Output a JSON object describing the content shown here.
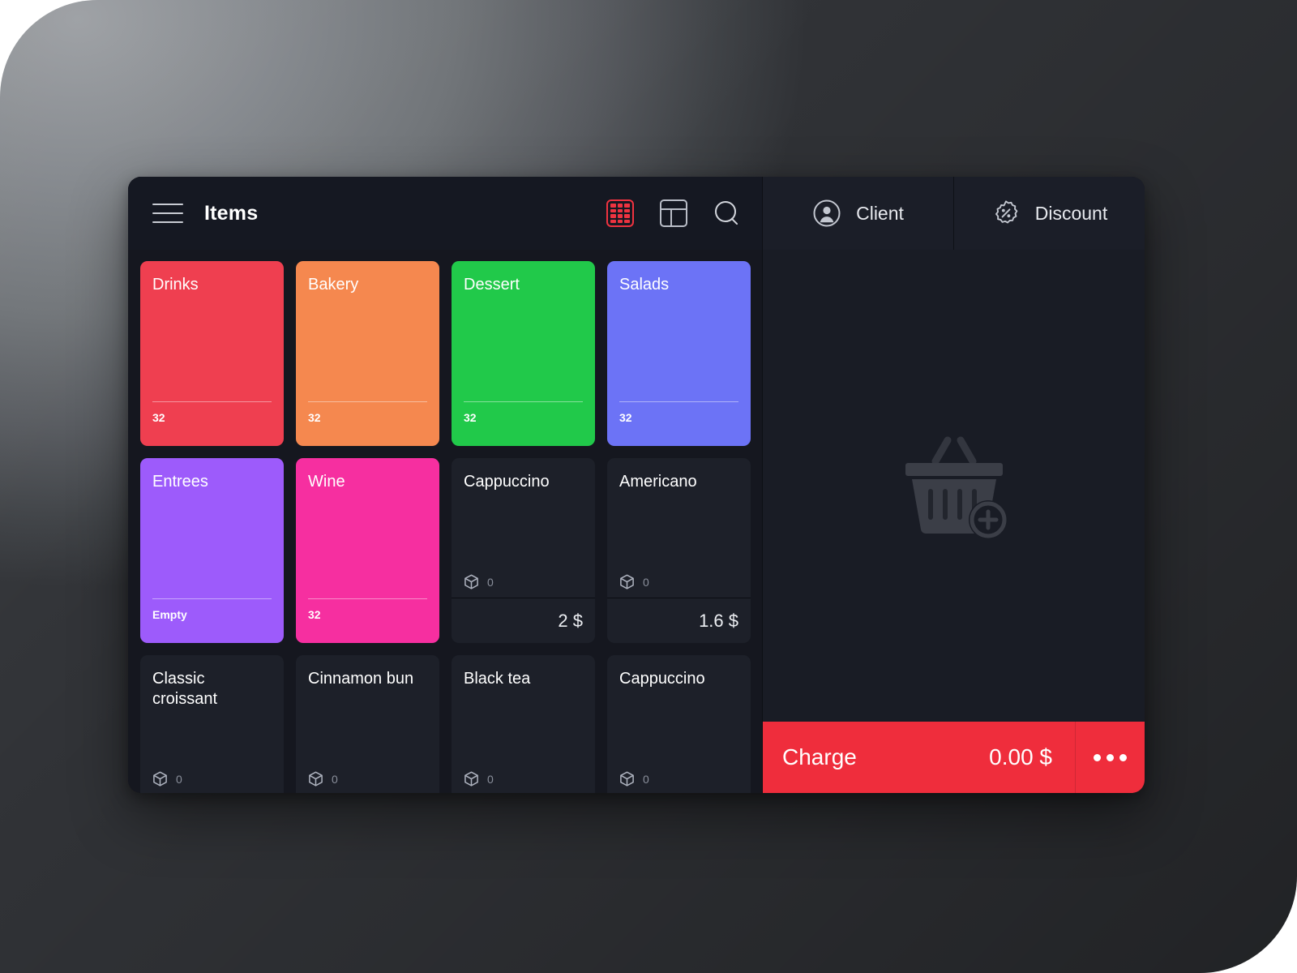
{
  "app": {
    "theme": {
      "panel_bg": "#15171f",
      "tile_bg": "#1d2029",
      "cart_bg": "#191c25",
      "accent_red": "#ef2d3c"
    }
  },
  "items_header": {
    "menu_icon": "hamburger-icon",
    "title": "Items",
    "tools": [
      {
        "name": "grid-view-icon",
        "active": true
      },
      {
        "name": "table-view-icon",
        "active": false
      },
      {
        "name": "search-icon",
        "active": false
      }
    ]
  },
  "tiles": [
    {
      "kind": "category",
      "name": "Drinks",
      "count": "32",
      "color": "#ef3f50"
    },
    {
      "kind": "category",
      "name": "Bakery",
      "count": "32",
      "color": "#f5884f"
    },
    {
      "kind": "category",
      "name": "Dessert",
      "count": "32",
      "color": "#21c94a"
    },
    {
      "kind": "category",
      "name": "Salads",
      "count": "32",
      "color": "#6c73f6"
    },
    {
      "kind": "category",
      "name": "Entrees",
      "count": "Empty",
      "color": "#9d5bfb"
    },
    {
      "kind": "category",
      "name": "Wine",
      "count": "32",
      "color": "#f62fa0"
    },
    {
      "kind": "product",
      "name": "Cappuccino",
      "stock": "0",
      "price": "2 $"
    },
    {
      "kind": "product",
      "name": "Americano",
      "stock": "0",
      "price": "1.6 $"
    },
    {
      "kind": "product",
      "name": "Classic croissant",
      "stock": "0",
      "price": ""
    },
    {
      "kind": "product",
      "name": "Cinnamon bun",
      "stock": "0",
      "price": ""
    },
    {
      "kind": "product",
      "name": "Black tea",
      "stock": "0",
      "price": ""
    },
    {
      "kind": "product",
      "name": "Cappuccino",
      "stock": "0",
      "price": ""
    }
  ],
  "cart": {
    "tabs": [
      {
        "label": "Client",
        "icon": "person-circle-icon"
      },
      {
        "label": "Discount",
        "icon": "discount-badge-icon"
      }
    ],
    "empty_state_icon": "basket-add-icon",
    "charge": {
      "label": "Charge",
      "amount": "0.00 $",
      "more_icon": "more-options-icon"
    }
  }
}
